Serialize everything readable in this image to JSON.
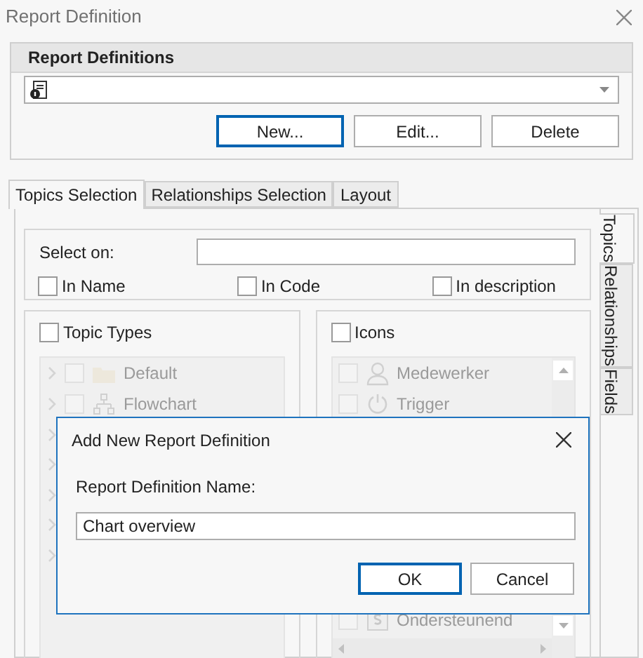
{
  "window": {
    "title": "Report Definition"
  },
  "report_definitions": {
    "title": "Report Definitions",
    "buttons": [
      {
        "label": "New...",
        "focused": true
      },
      {
        "label": "Edit...",
        "focused": false
      },
      {
        "label": "Delete",
        "focused": false
      }
    ]
  },
  "tabs": [
    {
      "label": "Topics Selection",
      "selected": true
    },
    {
      "label": "Relationships Selection",
      "selected": false
    },
    {
      "label": "Layout",
      "selected": false
    }
  ],
  "side_tabs": [
    {
      "label": "Topics",
      "selected": true
    },
    {
      "label": "Relationships",
      "selected": false
    },
    {
      "label": "Fields",
      "selected": false
    }
  ],
  "select_on": {
    "label": "Select on:",
    "options": [
      {
        "label": "In Name",
        "checked": false
      },
      {
        "label": "In Code",
        "checked": false
      },
      {
        "label": "In description",
        "checked": false
      }
    ]
  },
  "topic_types": {
    "label": "Topic Types",
    "checked": false,
    "disabled": true,
    "items": [
      {
        "label": "Default",
        "kind": "folder",
        "checked": false
      },
      {
        "label": "Flowchart",
        "kind": "flowchart",
        "checked": false
      }
    ]
  },
  "icons": {
    "label": "Icons",
    "checked": false,
    "disabled": true,
    "items": [
      {
        "label": "Medewerker",
        "kind": "person",
        "checked": false
      },
      {
        "label": "Trigger",
        "kind": "power",
        "checked": false
      },
      {
        "label": "Ondersteunend",
        "kind": "document",
        "checked": false
      }
    ]
  },
  "dialog": {
    "title": "Add New Report Definition",
    "field_label": "Report Definition Name:",
    "value": "Chart overview",
    "buttons": [
      {
        "label": "OK",
        "focused": true
      },
      {
        "label": "Cancel",
        "focused": false
      }
    ]
  }
}
